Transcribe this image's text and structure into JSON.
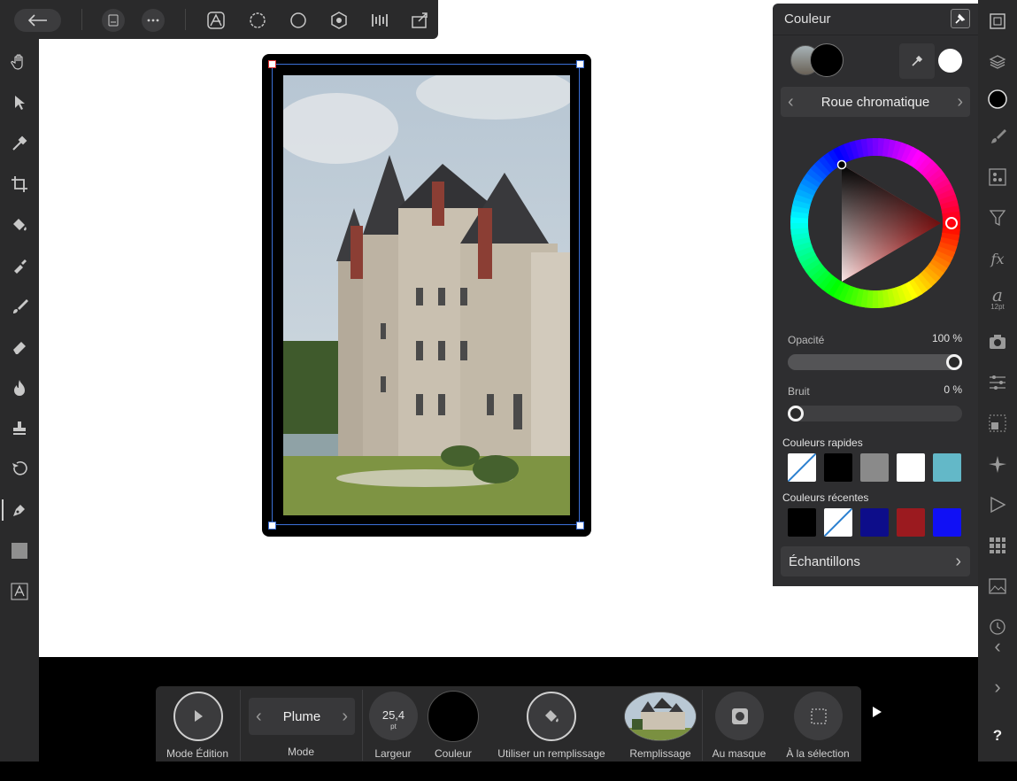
{
  "top_toolbar": {
    "back_icon": "arrow-left-icon",
    "icons": [
      "document-icon",
      "more-icon",
      "photo-persona-icon",
      "liquify-persona-icon",
      "develop-persona-icon",
      "tone-mapping-persona-icon",
      "export-persona-icon",
      "share-icon"
    ]
  },
  "left_toolbar": {
    "tools": [
      "hand-tool",
      "move-tool",
      "color-picker-tool",
      "crop-tool",
      "flood-fill-tool",
      "selection-brush-tool",
      "paint-brush-tool",
      "erase-brush-tool",
      "dodge-burn-tool",
      "clone-tool",
      "healing-brush-tool",
      "pen-tool",
      "rectangle-tool",
      "text-tool"
    ]
  },
  "right_toolbar": {
    "tools": [
      "navigator-icon",
      "layers-icon",
      "color-icon",
      "brushes-icon",
      "channels-icon",
      "filters-icon",
      "effects-icon",
      "text-styles-icon",
      "stock-icon",
      "adjustments-icon",
      "transform-icon",
      "navigator-star-icon",
      "macro-icon",
      "swatches-grid-icon",
      "histogram-icon",
      "history-icon",
      "undo-icon",
      "redo-icon",
      "help-icon"
    ],
    "text_style_size": "12pt",
    "fx_label": "fx",
    "help_label": "?"
  },
  "color_panel": {
    "title": "Couleur",
    "mode_label": "Roue chromatique",
    "fill_color": "#000000",
    "opacity_label": "Opacité",
    "opacity_value": "100 %",
    "opacity_level": 1.0,
    "noise_label": "Bruit",
    "noise_value": "0 %",
    "noise_level": 0.0,
    "quick_colors_label": "Couleurs rapides",
    "quick_colors": [
      "none",
      "#000000",
      "#8a8a8a",
      "#ffffff",
      "#63b8c8"
    ],
    "recent_colors_label": "Couleurs récentes",
    "recent_colors": [
      "#000000",
      "none",
      "#0d0d8a",
      "#9b1a1f",
      "#1010f5"
    ],
    "samples_label": "Échantillons"
  },
  "context_toolbar": {
    "edit_mode_label": "Mode Édition",
    "mode_value": "Plume",
    "mode_label": "Mode",
    "width_value": "25,4",
    "width_unit": "pt",
    "width_label": "Largeur",
    "color_label": "Couleur",
    "stroke_color": "#000000",
    "use_fill_label": "Utiliser un remplissage",
    "fill_label": "Remplissage",
    "mask_label": "Au masque",
    "selection_label": "À la sélection"
  }
}
